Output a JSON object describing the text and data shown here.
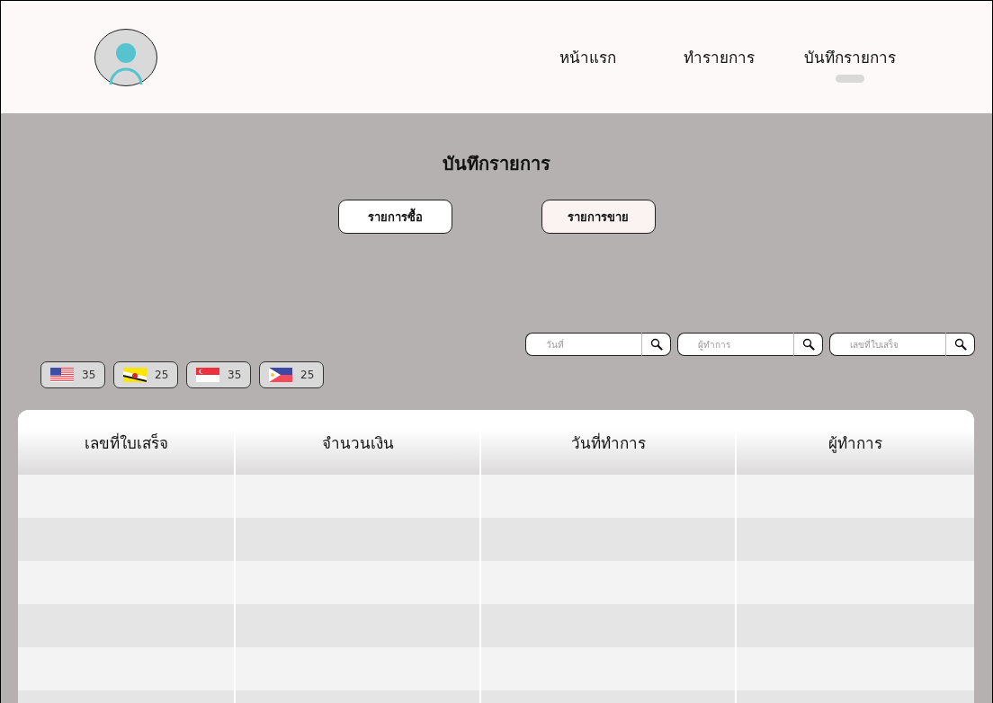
{
  "nav": {
    "items": [
      {
        "label": "หน้าแรก",
        "selected": false
      },
      {
        "label": "ทำรายการ",
        "selected": false
      },
      {
        "label": "บันทึกรายการ",
        "selected": true
      }
    ]
  },
  "page_title": "บันทึกรายการ",
  "tabs": [
    {
      "label": "รายการซื้อ",
      "selected": false
    },
    {
      "label": "รายการขาย",
      "selected": true
    }
  ],
  "search_fields": [
    {
      "placeholder": "วันที่"
    },
    {
      "placeholder": "ผู้ทำการ"
    },
    {
      "placeholder": "เลขที่ใบเสร็จ"
    }
  ],
  "currencies": [
    {
      "kind": "us",
      "count": "35"
    },
    {
      "kind": "bn",
      "count": "25"
    },
    {
      "kind": "sg",
      "count": "35"
    },
    {
      "kind": "ph",
      "count": "25"
    }
  ],
  "table": {
    "columns": [
      "เลขที่ใบเสร็จ",
      "จำนวนเงิน",
      "วันที่ทำการ",
      "ผู้ทำการ"
    ]
  }
}
